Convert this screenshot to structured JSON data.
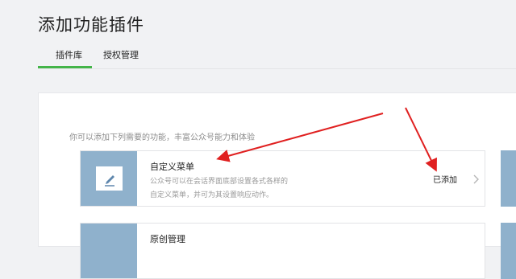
{
  "page": {
    "title": "添加功能插件"
  },
  "tabs": [
    {
      "label": "插件库",
      "active": true
    },
    {
      "label": "授权管理",
      "active": false
    }
  ],
  "content": {
    "hint": "你可以添加下列需要的功能，丰富公众号能力和体验"
  },
  "plugins": [
    {
      "name": "自定义菜单",
      "desc_line1": "公众号可以在会话界面底部设置各式各样的",
      "desc_line2": "自定义菜单，并可为其设置响应动作。",
      "status": "已添加",
      "icon": "pencil-icon"
    },
    {
      "name": "原创管理",
      "icon": "document-icon"
    }
  ],
  "colors": {
    "accent_green": "#44b549",
    "thumb_blue": "#8fb1cc",
    "arrow_red": "#e02020"
  }
}
